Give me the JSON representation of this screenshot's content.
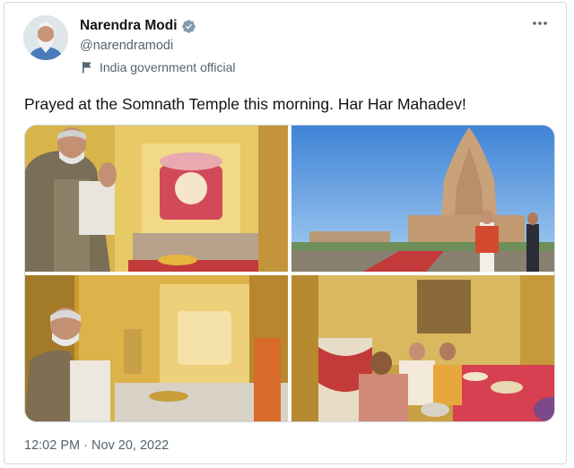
{
  "author": {
    "display_name": "Narendra Modi",
    "handle": "@narendramodi",
    "affiliation_label": "India government official",
    "verified_icon": "verified-badge-icon",
    "colors": {
      "verified": "#829aab"
    }
  },
  "post": {
    "text": "Prayed at the Somnath Temple this morning. Har Har Mahadev!",
    "time": "12:02 PM",
    "separator": "·",
    "date": "Nov 20, 2022"
  },
  "media": {
    "photos": [
      {
        "subject": "devotee praying before golden shrine"
      },
      {
        "subject": "temple spire under blue sky"
      },
      {
        "subject": "seated at golden shrine"
      },
      {
        "subject": "puja ritual with priests"
      }
    ]
  },
  "colors": {
    "text": "#0f1419",
    "secondary": "#536471",
    "border": "#cfd9de"
  }
}
